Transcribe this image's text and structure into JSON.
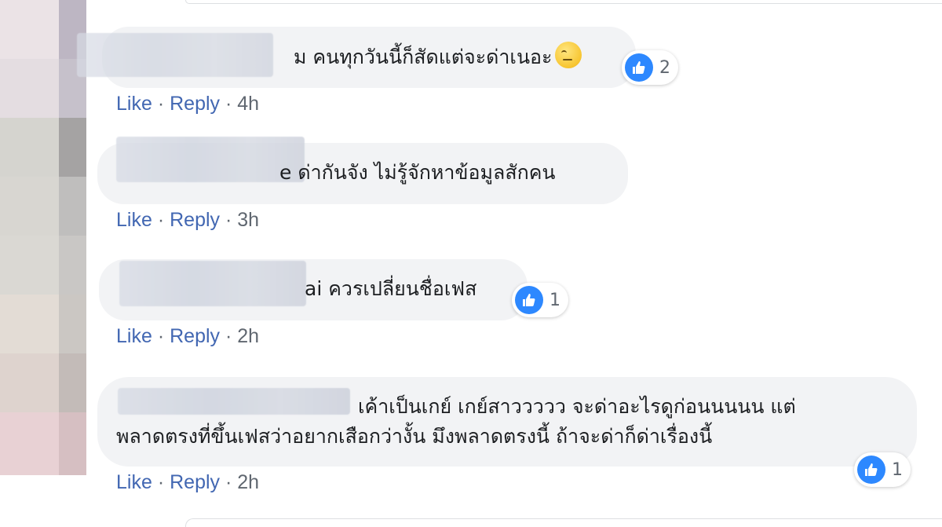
{
  "comments": [
    {
      "text": "ม คนทุกวันนี้ก็สัดแต่จะด่าเนอะ",
      "emoji": "face-with-rolling-eyes",
      "like_count": "2",
      "actions": {
        "like": "Like",
        "reply": "Reply",
        "sep": "·",
        "time": "4h"
      }
    },
    {
      "text": "e ด่ากันจัง ไม่รู้จักหาข้อมูลสักคน",
      "actions": {
        "like": "Like",
        "reply": "Reply",
        "sep": "·",
        "time": "3h"
      }
    },
    {
      "text": "ai ควรเปลี่ยนชื่อเฟส",
      "like_count": "1",
      "actions": {
        "like": "Like",
        "reply": "Reply",
        "sep": "·",
        "time": "2h"
      }
    },
    {
      "text_line1": "เค้าเป็นเกย์ เกย์สาววววว จะด่าอะไรดูก่อนนนนน แต่",
      "text_line2": "พลาดตรงที่ขึ้นเฟสว่าอยากเสือกว่างั้น มึงพลาดตรงนี้ ถ้าจะด่าก็ด่าเรื่องนี้",
      "like_count": "1",
      "actions": {
        "like": "Like",
        "reply": "Reply",
        "sep": "·",
        "time": "2h"
      }
    }
  ],
  "colors": {
    "bubble": "#f2f3f5",
    "link": "#4267b2",
    "meta": "#606770",
    "like_blue": "#2d88ff"
  }
}
